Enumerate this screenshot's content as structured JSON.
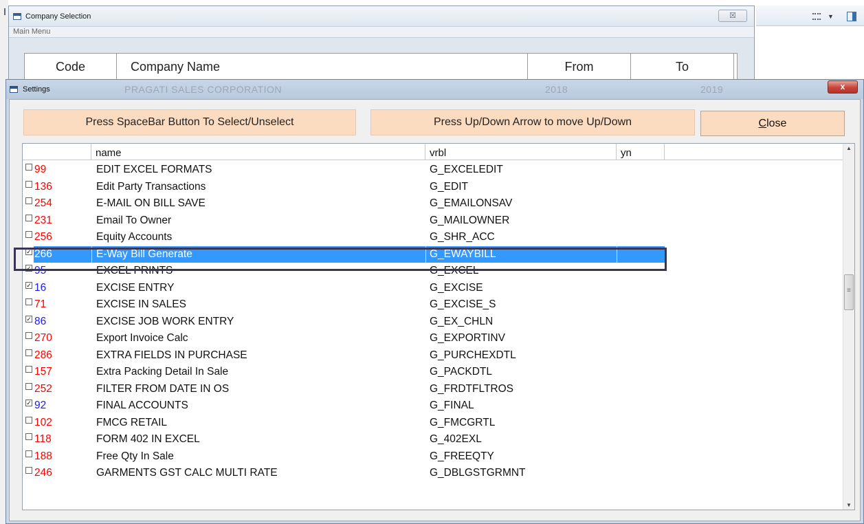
{
  "company_window": {
    "title": "Company Selection",
    "close_glyph": "☒",
    "menu": "Main Menu",
    "columns": {
      "code": "Code",
      "name": "Company Name",
      "from": "From",
      "to": "To"
    },
    "ghost_row": {
      "name": "PRAGATI SALES CORPORATION",
      "from": "2018",
      "to": "2019"
    }
  },
  "settings_window": {
    "title": "Settings",
    "close_glyph": "x",
    "hint_select": "Press SpaceBar Button To Select/Unselect",
    "hint_move": "Press Up/Down Arrow to move Up/Down",
    "close_button": {
      "mnemonic": "C",
      "rest": "lose"
    },
    "grid": {
      "headers": {
        "name": "name",
        "vrbl": "vrbl",
        "yn": "yn"
      },
      "rows": [
        {
          "checked": false,
          "num": "99",
          "name": "EDIT EXCEL FORMATS",
          "vrbl": "G_EXCELEDIT",
          "color": "red"
        },
        {
          "checked": false,
          "num": "136",
          "name": "Edit Party Transactions",
          "vrbl": "G_EDIT",
          "color": "red"
        },
        {
          "checked": false,
          "num": "254",
          "name": "E-MAIL ON BILL SAVE",
          "vrbl": "G_EMAILONSAV",
          "color": "red"
        },
        {
          "checked": false,
          "num": "231",
          "name": "Email To Owner",
          "vrbl": "G_MAILOWNER",
          "color": "red"
        },
        {
          "checked": false,
          "num": "256",
          "name": "Equity Accounts",
          "vrbl": "G_SHR_ACC",
          "color": "red"
        },
        {
          "checked": true,
          "num": "266",
          "name": "E-Way Bill Generate",
          "vrbl": "G_EWAYBILL",
          "color": "white",
          "selected": true
        },
        {
          "checked": true,
          "num": "95",
          "name": "EXCEL PRINTS",
          "vrbl": "G_EXCEL",
          "color": "blue"
        },
        {
          "checked": true,
          "num": "16",
          "name": "EXCISE ENTRY",
          "vrbl": "G_EXCISE",
          "color": "blue"
        },
        {
          "checked": false,
          "num": "71",
          "name": "EXCISE IN SALES",
          "vrbl": "G_EXCISE_S",
          "color": "red"
        },
        {
          "checked": true,
          "num": "86",
          "name": "EXCISE JOB WORK ENTRY",
          "vrbl": "G_EX_CHLN",
          "color": "blue"
        },
        {
          "checked": false,
          "num": "270",
          "name": "Export Invoice Calc",
          "vrbl": "G_EXPORTINV",
          "color": "red"
        },
        {
          "checked": false,
          "num": "286",
          "name": "EXTRA FIELDS IN PURCHASE",
          "vrbl": "G_PURCHEXDTL",
          "color": "red"
        },
        {
          "checked": false,
          "num": "157",
          "name": "Extra Packing Detail In Sale",
          "vrbl": "G_PACKDTL",
          "color": "red"
        },
        {
          "checked": false,
          "num": "252",
          "name": "FILTER FROM DATE IN OS",
          "vrbl": "G_FRDTFLTROS",
          "color": "red"
        },
        {
          "checked": true,
          "num": "92",
          "name": "FINAL ACCOUNTS",
          "vrbl": "G_FINAL",
          "color": "blue"
        },
        {
          "checked": false,
          "num": "102",
          "name": "FMCG RETAIL",
          "vrbl": "G_FMCGRTL",
          "color": "red"
        },
        {
          "checked": false,
          "num": "118",
          "name": "FORM 402 IN EXCEL",
          "vrbl": "G_402EXL",
          "color": "red"
        },
        {
          "checked": false,
          "num": "188",
          "name": "Free Qty In Sale",
          "vrbl": "G_FREEQTY",
          "color": "red"
        },
        {
          "checked": false,
          "num": "246",
          "name": "GARMENTS GST CALC MULTI RATE",
          "vrbl": "G_DBLGSTGRMNT",
          "color": "red"
        }
      ]
    }
  },
  "icons": {
    "app": "window-app-icon",
    "view": "view-options-icon",
    "dropdown": "chevron-down-icon",
    "pane": "preview-pane-icon",
    "scroll_up": "scroll-up-arrow-icon",
    "scroll_down": "scroll-down-arrow-icon"
  }
}
